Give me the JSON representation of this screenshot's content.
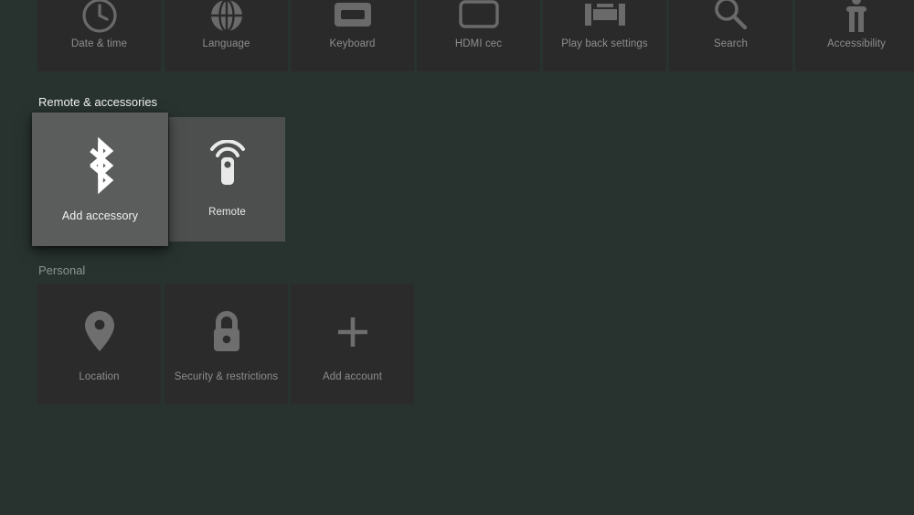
{
  "screen": {
    "background_color": "#28332f",
    "tile_color": "#2b2b2b",
    "focused_tile_color": "#5b5d5c",
    "unfocused_remote_tile_color": "#4d4f4e",
    "dim_label_color": "#8e8e8e",
    "bright_label_color": "#f1f1f1"
  },
  "sections": [
    {
      "id": "system",
      "header": "",
      "header_visible": false,
      "tiles": [
        {
          "label": "Date & time",
          "icon": "clock-icon"
        },
        {
          "label": "Language",
          "icon": "globe-icon"
        },
        {
          "label": "Keyboard",
          "icon": "keyboard-icon"
        },
        {
          "label": "HDMI cec",
          "icon": "tv-screen-icon"
        },
        {
          "label": "Play back settings",
          "icon": "film-strip-icon"
        },
        {
          "label": "Search",
          "icon": "magnifier-icon"
        },
        {
          "label": "Accessibility",
          "icon": "accessibility-icon"
        }
      ]
    },
    {
      "id": "remote-accessories",
      "header": "Remote & accessories",
      "header_visible": true,
      "tiles": [
        {
          "label": "Add accessory",
          "icon": "bluetooth-icon",
          "focused": true
        },
        {
          "label": "Remote",
          "icon": "remote-control-icon",
          "focused": false
        }
      ]
    },
    {
      "id": "personal",
      "header": "Personal",
      "header_visible": true,
      "tiles": [
        {
          "label": "Location",
          "icon": "location-pin-icon"
        },
        {
          "label": "Security & restrictions",
          "icon": "lock-icon"
        },
        {
          "label": "Add account",
          "icon": "plus-icon"
        }
      ]
    }
  ]
}
